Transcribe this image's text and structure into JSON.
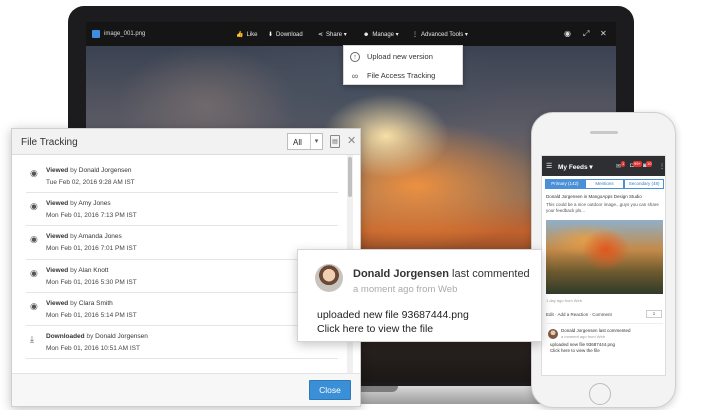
{
  "viewer": {
    "file_name": "image_001.png",
    "toolbar": {
      "like": "Like",
      "download": "Download",
      "share": "Share ▾",
      "manage": "Manage ▾",
      "advanced": "Advanced Tools ▾"
    },
    "manage_menu": [
      {
        "label": "Upload new version",
        "icon": "upload-icon"
      },
      {
        "label": "File Access Tracking",
        "icon": "glasses-icon"
      }
    ]
  },
  "tracking": {
    "title": "File Tracking",
    "filter_value": "All",
    "entries": [
      {
        "action": "Viewed",
        "by": "by",
        "user": "Donald Jorgensen",
        "time": "Tue Feb 02, 2016 9:28 AM IST",
        "icon": "eye-icon"
      },
      {
        "action": "Viewed",
        "by": "by",
        "user": "Amy Jones",
        "time": "Mon Feb 01, 2016 7:13 PM IST",
        "icon": "eye-icon"
      },
      {
        "action": "Viewed",
        "by": "by",
        "user": "Amanda Jones",
        "time": "Mon Feb 01, 2016 7:01 PM IST",
        "icon": "eye-icon"
      },
      {
        "action": "Viewed",
        "by": "by",
        "user": "Alan Knott",
        "time": "Mon Feb 01, 2016 5:30 PM IST",
        "icon": "eye-icon"
      },
      {
        "action": "Viewed",
        "by": "by",
        "user": "Clara Smith",
        "time": "Mon Feb 01, 2016 5:14 PM IST",
        "icon": "eye-icon"
      },
      {
        "action": "Downloaded",
        "by": "by",
        "user": "Donald Jorgensen",
        "time": "Mon Feb 01, 2016 10:51 AM IST",
        "icon": "download-icon"
      }
    ],
    "close_label": "Close"
  },
  "phone": {
    "title": "My Feeds ▾",
    "badges": [
      "1",
      "99+",
      "10"
    ],
    "tabs": [
      {
        "label": "Primary (142)",
        "active": true
      },
      {
        "label": "Mentions",
        "active": false
      },
      {
        "label": "Secondary (48)",
        "active": false
      }
    ],
    "post_head": "Donald Jorgensen in MangoApps Design Studio",
    "post_text": "This could be a nice outdoor image...guys you can share your feedback pls...",
    "image_caption": "1 day ago from Web",
    "actions": "Edit · Add a Reaction · Comment",
    "comment_count": "1",
    "notif_line1": "Donald Jorgensen last commented",
    "notif_line2": "a moment ago from Web",
    "notif_line3": "uploaded new file 93687444.png",
    "notif_line4": "Click here to view the file"
  },
  "callout": {
    "name": "Donald Jorgensen",
    "verb": "last commented",
    "meta": "a moment ago from Web",
    "line1": "uploaded new file 93687444.png",
    "line2": "Click here to view the file"
  },
  "colors": {
    "accent": "#3b8fd6",
    "toolbar_bg": "#151515",
    "badge_red": "#e2322f"
  }
}
